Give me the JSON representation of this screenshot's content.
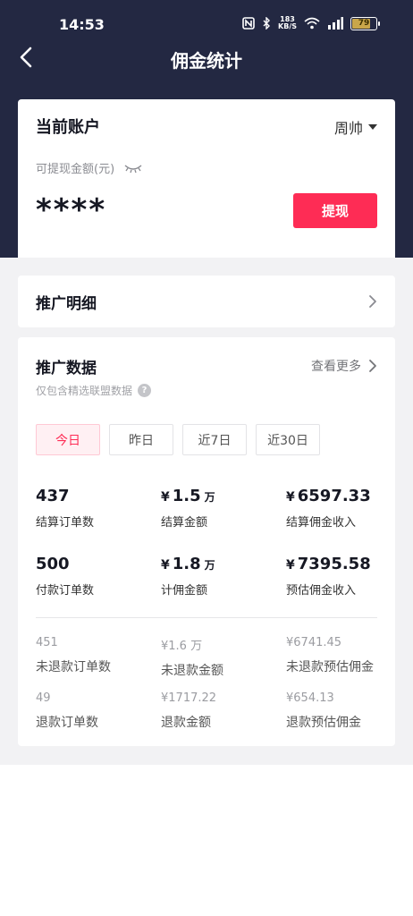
{
  "status_bar": {
    "time": "14:53",
    "net_speed_top": "183",
    "net_speed_bottom": "KB/S",
    "battery": "79",
    "icons": [
      "nfc-icon",
      "bluetooth-icon",
      "wifi-icon",
      "signal-icon",
      "battery-icon"
    ]
  },
  "nav": {
    "title": "佣金统计",
    "back_icon": "chevron-left-icon"
  },
  "account": {
    "title": "当前账户",
    "user": "周帅",
    "available_label": "可提现金额(元)",
    "masked_amount": "****",
    "withdraw_label": "提现"
  },
  "detail": {
    "title": "推广明细"
  },
  "promo": {
    "title": "推广数据",
    "more_label": "查看更多",
    "subtitle": "仅包含精选联盟数据",
    "help_glyph": "?",
    "tabs": [
      {
        "label": "今日",
        "active": true
      },
      {
        "label": "昨日",
        "active": false
      },
      {
        "label": "近7日",
        "active": false
      },
      {
        "label": "近30日",
        "active": false
      }
    ],
    "stats": {
      "settled_orders": {
        "value": "437",
        "label": "结算订单数"
      },
      "settled_amount": {
        "yen": "¥",
        "value": "1.5",
        "unit": "万",
        "label": "结算金额"
      },
      "settled_commission": {
        "yen": "¥",
        "value": "6597.33",
        "label": "结算佣金收入"
      },
      "paid_orders": {
        "value": "500",
        "label": "付款订单数"
      },
      "commission_amount": {
        "yen": "¥",
        "value": "1.8",
        "unit": "万",
        "label": "计佣金额"
      },
      "estimated_commission": {
        "yen": "¥",
        "value": "7395.58",
        "label": "预估佣金收入"
      }
    },
    "minor_stats": {
      "unrefunded_orders": {
        "value": "451",
        "label": "未退款订单数"
      },
      "unrefunded_amount": {
        "value": "¥1.6 万",
        "label": "未退款金额"
      },
      "unrefunded_commission": {
        "value": "¥6741.45",
        "label": "未退款预估佣金"
      },
      "refund_orders": {
        "value": "49",
        "label": "退款订单数"
      },
      "refund_amount": {
        "value": "¥1717.22",
        "label": "退款金额"
      },
      "refund_commission": {
        "value": "¥654.13",
        "label": "退款预估佣金"
      }
    }
  },
  "colors": {
    "header_bg": "#232842",
    "accent": "#fe2c55",
    "page_bg": "#f2f2f4"
  }
}
